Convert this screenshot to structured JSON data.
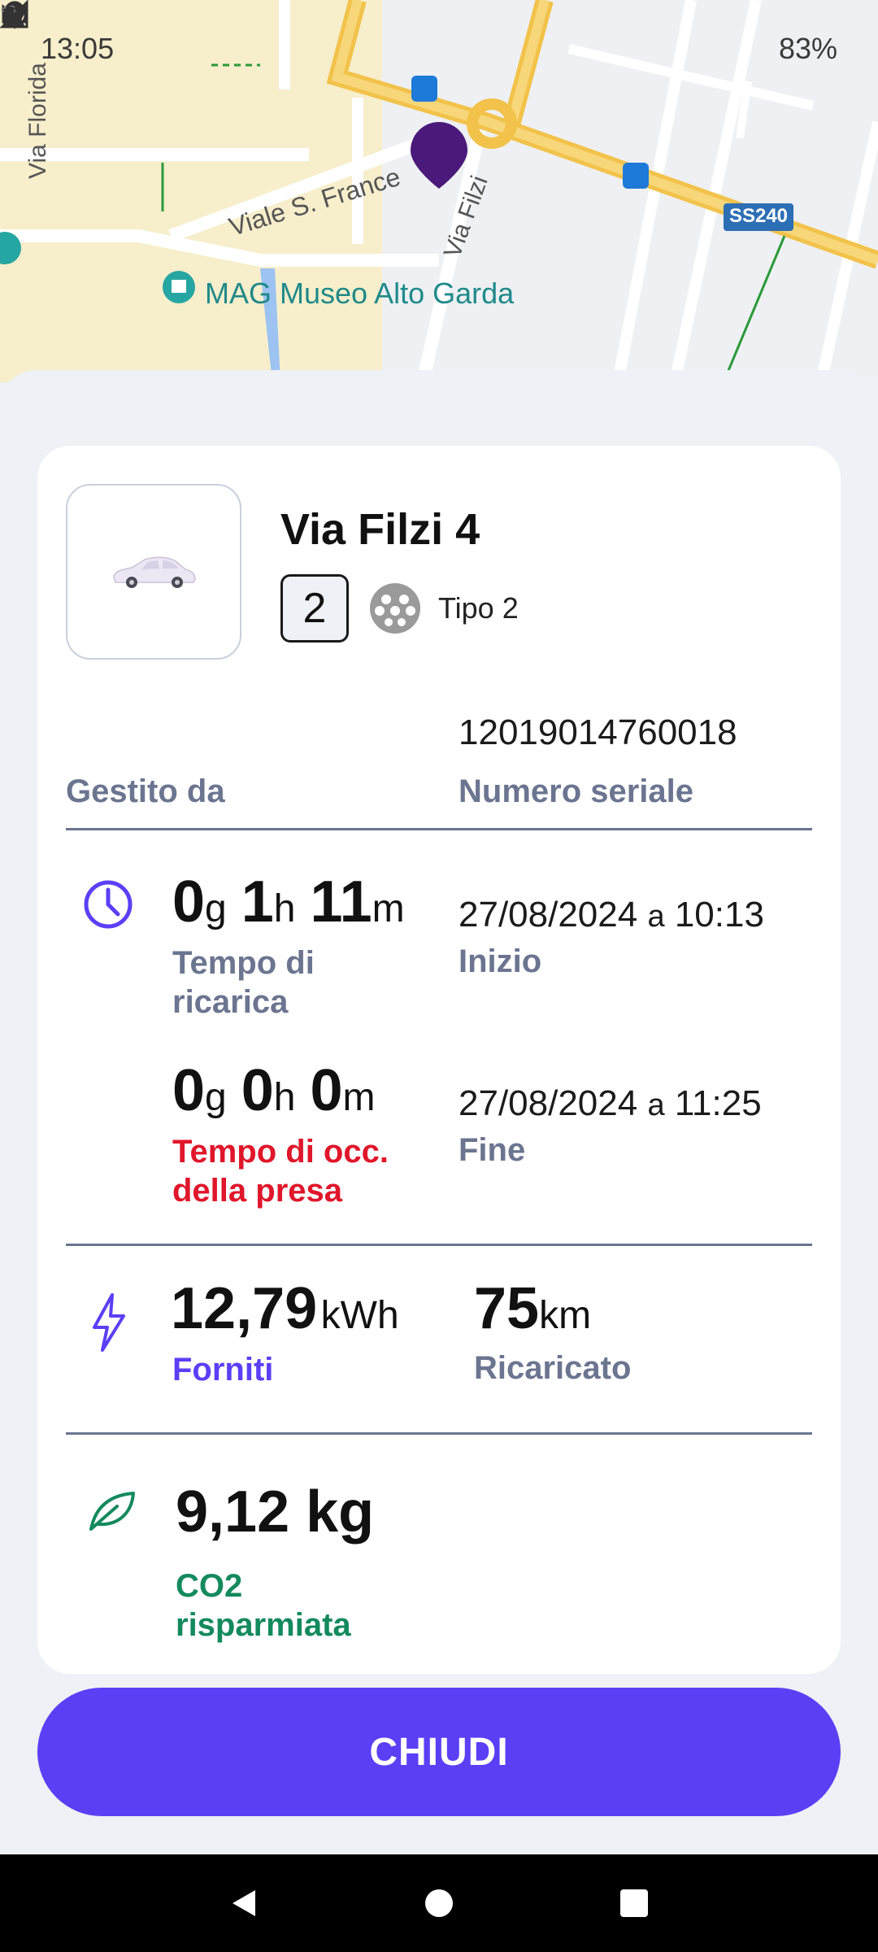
{
  "status_bar": {
    "time": "13:05",
    "battery": "83%",
    "notification_icons": [
      "whatsapp-icon",
      "a-icon",
      "gmail-icon",
      "gmail-icon",
      "dot-icon"
    ],
    "system_icons": [
      "location-icon",
      "volte-icon",
      "wifi-icon",
      "4g-icon",
      "signal-icon",
      "battery-icon"
    ]
  },
  "map": {
    "labels": {
      "street_florida": "Via Florida",
      "street_viale": "Viale S. France",
      "street_filzi": "Via Filzi",
      "road_badge": "SS240",
      "museum": "MAG Museo Alto Garda"
    },
    "marker_color": "#4a1a7a"
  },
  "station": {
    "title": "Via Filzi 4",
    "connector_count": "2",
    "connector_type": "Tipo 2",
    "serial_number": "12019014760018",
    "managed_by_label": "Gestito da",
    "serial_label": "Numero seriale"
  },
  "charge_time": {
    "days": "0",
    "days_unit": "g",
    "hours": "1",
    "hours_unit": "h",
    "minutes": "11",
    "minutes_unit": "m",
    "label": "Tempo di ricarica"
  },
  "occupation_time": {
    "days": "0",
    "days_unit": "g",
    "hours": "0",
    "hours_unit": "h",
    "minutes": "0",
    "minutes_unit": "m",
    "label": "Tempo di occ. della presa"
  },
  "start": {
    "date": "27/08/2024",
    "connector": "a",
    "time": "10:13",
    "label": "Inizio"
  },
  "end": {
    "date": "27/08/2024",
    "connector": "a",
    "time": "11:25",
    "label": "Fine"
  },
  "energy": {
    "value": "12,79",
    "unit": "kWh",
    "label": "Forniti"
  },
  "distance": {
    "value": "75",
    "unit": "km",
    "label": "Ricaricato"
  },
  "co2": {
    "value": "9,12 kg",
    "label": "CO2 risparmiata"
  },
  "actions": {
    "close_label": "CHIUDI"
  },
  "colors": {
    "accent": "#5b3ff5",
    "warning": "#e0162b",
    "eco": "#138a5e",
    "muted": "#6b7590"
  }
}
